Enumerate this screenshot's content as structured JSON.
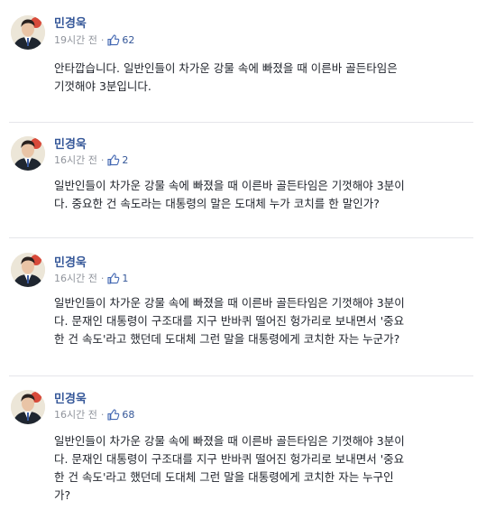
{
  "comments": [
    {
      "author": "민경욱",
      "time": "19시간 전",
      "separator": "·",
      "likes": "62",
      "lines": [
        "안타깝습니다. 일반인들이 차가운 강물 속에 빠졌을 때 이른바 골든타임은",
        "기껏해야 3분입니다."
      ]
    },
    {
      "author": "민경욱",
      "time": "16시간 전",
      "separator": "·",
      "likes": "2",
      "lines": [
        "일반인들이 차가운 강물 속에 빠졌을 때 이른바 골든타임은 기껏해야 3분이",
        "다. 중요한 건 속도라는 대통령의 말은 도대체 누가 코치를 한 말인가?"
      ]
    },
    {
      "author": "민경욱",
      "time": "16시간 전",
      "separator": "·",
      "likes": "1",
      "lines": [
        "일반인들이 차가운 강물 속에 빠졌을 때 이른바 골든타임은 기껏해야 3분이",
        "다. 문재인 대통령이 구조대를 지구 반바퀴 떨어진 헝가리로 보내면서 '중요",
        "한 건 속도'라고 했던데 도대체 그런 말을 대통령에게 코치한 자는 누군가?"
      ]
    },
    {
      "author": "민경욱",
      "time": "16시간 전",
      "separator": "·",
      "likes": "68",
      "lines": [
        "일반인들이 차가운 강물 속에 빠졌을 때 이른바 골든타임은 기껏해야 3분이",
        "다. 문재인 대통령이 구조대를 지구 반바퀴 떨어진 헝가리로 보내면서 '중요",
        "한 건 속도'라고 했던데 도대체 그런 말을 대통령에게 코치한 자는 누구인",
        "가?"
      ]
    }
  ],
  "colors": {
    "author": "#365899",
    "meta": "#90949c",
    "body": "#1d2129",
    "like_icon": "#4267b2",
    "divider": "#e5e6ea"
  },
  "icons": {
    "like": "thumbs-up-icon"
  }
}
